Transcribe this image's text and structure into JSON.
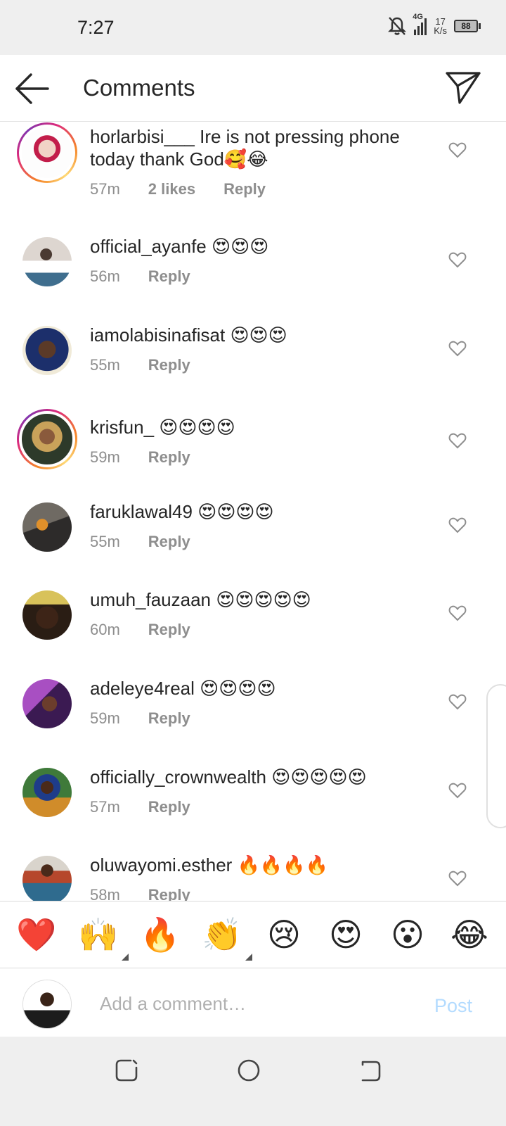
{
  "status_bar": {
    "time": "7:27",
    "network": "4G",
    "speed_value": "17",
    "speed_unit": "K/s",
    "battery": "88"
  },
  "header": {
    "title": "Comments",
    "back_icon": "arrow-left-icon",
    "share_icon": "paper-plane-icon"
  },
  "comments": [
    {
      "username": "horlarbisi___",
      "text": "Ire is not pressing phone today thank God🥰😂",
      "time": "57m",
      "likes": "2 likes",
      "reply": "Reply",
      "story_ring": true
    },
    {
      "username": "official_ayanfe",
      "text": "😍😍😍",
      "time": "56m",
      "reply": "Reply",
      "story_ring": false
    },
    {
      "username": "iamolabisinafisat",
      "text": "😍😍😍",
      "time": "55m",
      "reply": "Reply",
      "story_ring": false
    },
    {
      "username": "krisfun_",
      "text": "😍😍😍😍",
      "time": "59m",
      "reply": "Reply",
      "story_ring": true
    },
    {
      "username": "faruklawal49",
      "text": "😍😍😍😍",
      "time": "55m",
      "reply": "Reply",
      "story_ring": false
    },
    {
      "username": "umuh_fauzaan",
      "text": "😍😍😍😍😍",
      "time": "60m",
      "reply": "Reply",
      "story_ring": false
    },
    {
      "username": "adeleye4real",
      "text": "😍😍😍😍",
      "time": "59m",
      "reply": "Reply",
      "story_ring": false
    },
    {
      "username": "officially_crownwealth",
      "text": "😍😍😍😍😍",
      "time": "57m",
      "reply": "Reply",
      "story_ring": false
    },
    {
      "username": "oluwayomi.esther",
      "text": "🔥🔥🔥🔥",
      "time": "58m",
      "reply": "Reply",
      "story_ring": false
    }
  ],
  "reactions": [
    "❤️",
    "🙌",
    "🔥",
    "👏",
    "😢",
    "😍",
    "😮",
    "😂"
  ],
  "composer": {
    "placeholder": "Add a comment…",
    "post_label": "Post"
  },
  "colors": {
    "post_disabled": "#b3dbff",
    "meta_gray": "#8e8e8e",
    "text": "#262626"
  }
}
